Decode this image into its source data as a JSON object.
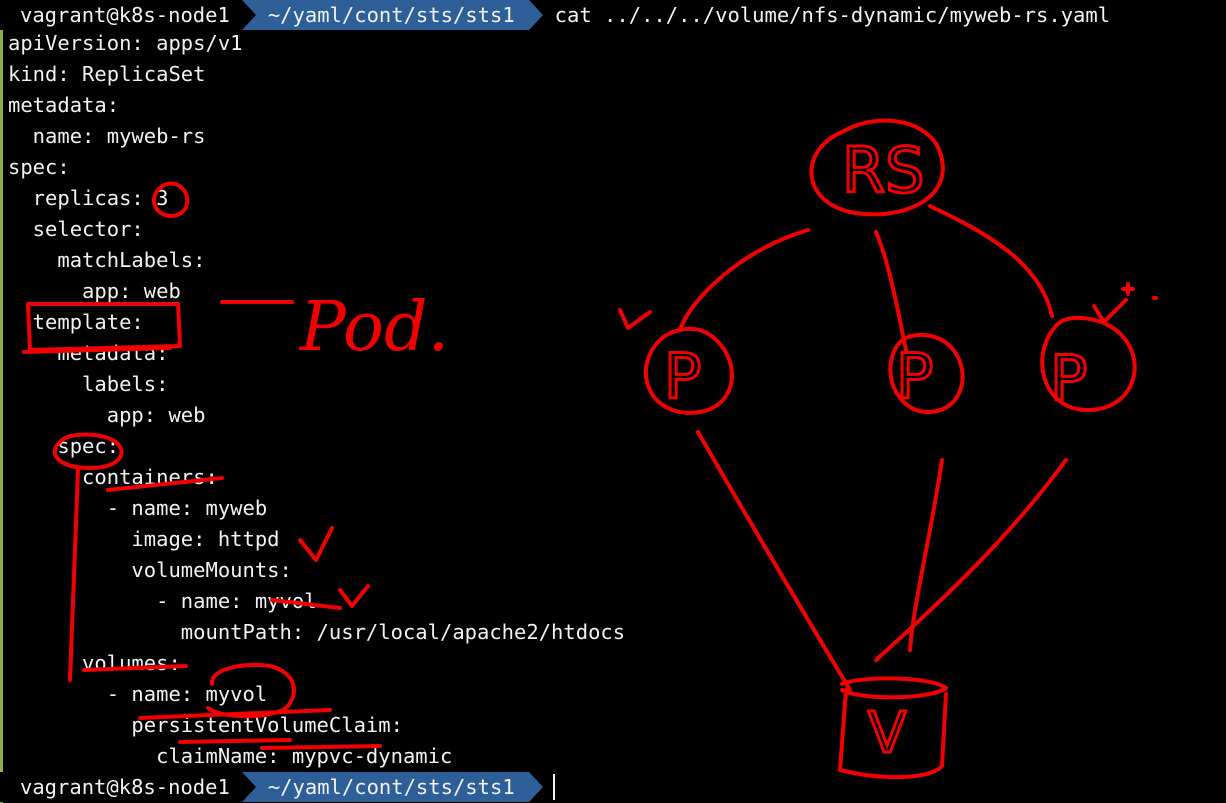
{
  "prompt_top": {
    "user_host": "vagrant@k8s-node1",
    "path": "~/yaml/cont/sts/sts1",
    "command": "cat ../../../volume/nfs-dynamic/myweb-rs.yaml"
  },
  "yaml_lines": [
    "apiVersion: apps/v1",
    "kind: ReplicaSet",
    "metadata:",
    "  name: myweb-rs",
    "spec:",
    "  replicas: 3",
    "  selector:",
    "    matchLabels:",
    "      app: web",
    "  template:",
    "    metadata:",
    "      labels:",
    "        app: web",
    "    spec:",
    "      containers:",
    "        - name: myweb",
    "          image: httpd",
    "          volumeMounts:",
    "            - name: myvol",
    "              mountPath: /usr/local/apache2/htdocs",
    "      volumes:",
    "        - name: myvol",
    "          persistentVolumeClaim:",
    "            claimName: mypvc-dynamic"
  ],
  "prompt_bottom": {
    "user_host": "vagrant@k8s-node1",
    "path": "~/yaml/cont/sts/sts1"
  },
  "annotations": {
    "pod_label": "Pod.",
    "rs_label": "RS",
    "pod_node_label": "P",
    "volume_label": "V",
    "ink_color": "#f00000"
  },
  "colors": {
    "background": "#000000",
    "text": "#f2f2f2",
    "path_segment": "#2e5f98",
    "side_bar": "#8ab04a"
  }
}
